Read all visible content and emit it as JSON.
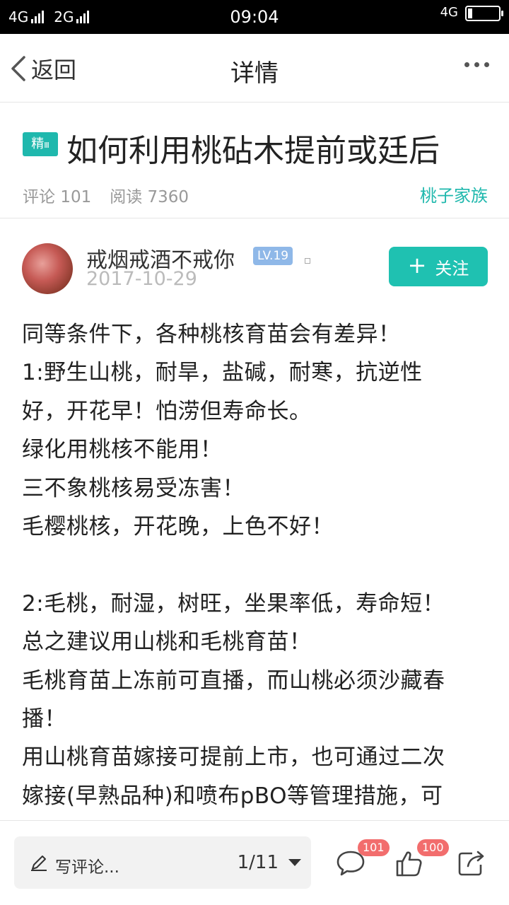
{
  "status_bar": {
    "signal_left": "4G",
    "signal_right": "2G",
    "time": "09:04",
    "network": "4G",
    "battery_level": 0.15
  },
  "nav": {
    "back_label": "返回",
    "title": "详情",
    "more_icon": "more-dots-icon"
  },
  "post": {
    "badge_main": "精",
    "badge_sub": "Ⅲ",
    "title": "如何利用桃砧木提前或廷后",
    "comments_label": "评论",
    "comments_count": "101",
    "reads_label": "阅读",
    "reads_count": "7360",
    "group": "桃子家族"
  },
  "author": {
    "name": "戒烟戒酒不戒你",
    "level": "LV.19",
    "date": "2017-10-29",
    "follow_plus": "+",
    "follow_label": "关注"
  },
  "article": {
    "lines": [
      "同等条件下，各种桃核育苗会有差异！",
      "1:野生山桃，耐旱，盐碱，耐寒，抗逆性",
      "好，开花早！怕涝但寿命长。",
      "绿化用桃核不能用！",
      "三不象桃核易受冻害！",
      "毛樱桃核，开花晚，上色不好！",
      "",
      "2:毛桃，耐湿，树旺，坐果率低，寿命短！",
      "总之建议用山桃和毛桃育苗！",
      "毛桃育苗上冻前可直播，而山桃必须沙藏春",
      "播！",
      "用山桃育苗嫁接可提前上市，也可通过二次",
      "嫁接(早熟品种)和喷布pBO等管理措施，可"
    ]
  },
  "bottom_bar": {
    "comment_placeholder": "写评论...",
    "page_indicator": "1/11",
    "comment_count": "101",
    "like_count": "100",
    "icons": [
      "pen-icon",
      "comment-icon",
      "like-icon",
      "share-icon"
    ]
  },
  "colors": {
    "accent": "#1fc1b1",
    "badge": "#1fb8ad",
    "level_badge": "#8fb8e8",
    "count_badge": "#f26d6d"
  }
}
